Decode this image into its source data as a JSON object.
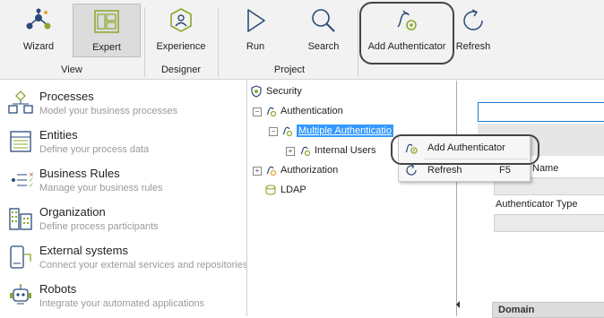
{
  "ribbon": {
    "buttons": {
      "wizard": "Wizard",
      "expert": "Expert",
      "experience": "Experience",
      "run": "Run",
      "search": "Search",
      "add_authenticator": "Add Authenticator",
      "refresh": "Refresh"
    },
    "groups": {
      "view": "View",
      "designer": "Designer",
      "project": "Project"
    }
  },
  "nav": [
    {
      "title": "Processes",
      "subtitle": "Model your business processes",
      "icon": "processes-icon"
    },
    {
      "title": "Entities",
      "subtitle": "Define your process data",
      "icon": "entities-icon"
    },
    {
      "title": "Business  Rules",
      "subtitle": "Manage your business rules",
      "icon": "business-rules-icon"
    },
    {
      "title": "Organization",
      "subtitle": "Define process participants",
      "icon": "organization-icon"
    },
    {
      "title": "External systems",
      "subtitle": "Connect your external services and repositories",
      "icon": "external-systems-icon"
    },
    {
      "title": "Robots",
      "subtitle": "Integrate your automated applications",
      "icon": "robots-icon"
    }
  ],
  "tree": {
    "security": "Security",
    "authentication": "Authentication",
    "multiple_authentication": "Multiple Authenticatio",
    "internal_users": "Internal Users",
    "authorization": "Authorization",
    "ldap": "LDAP"
  },
  "context_menu": {
    "add_authenticator": "Add Authenticator",
    "refresh": "Refresh",
    "refresh_shortcut": "F5"
  },
  "form": {
    "name_label": "Name",
    "authenticator_type_label": "Authenticator Type",
    "domain_header": "Domain"
  },
  "colors": {
    "accent": "#1e7bd0",
    "selection": "#3399ff",
    "icon_green": "#8aa82a"
  }
}
